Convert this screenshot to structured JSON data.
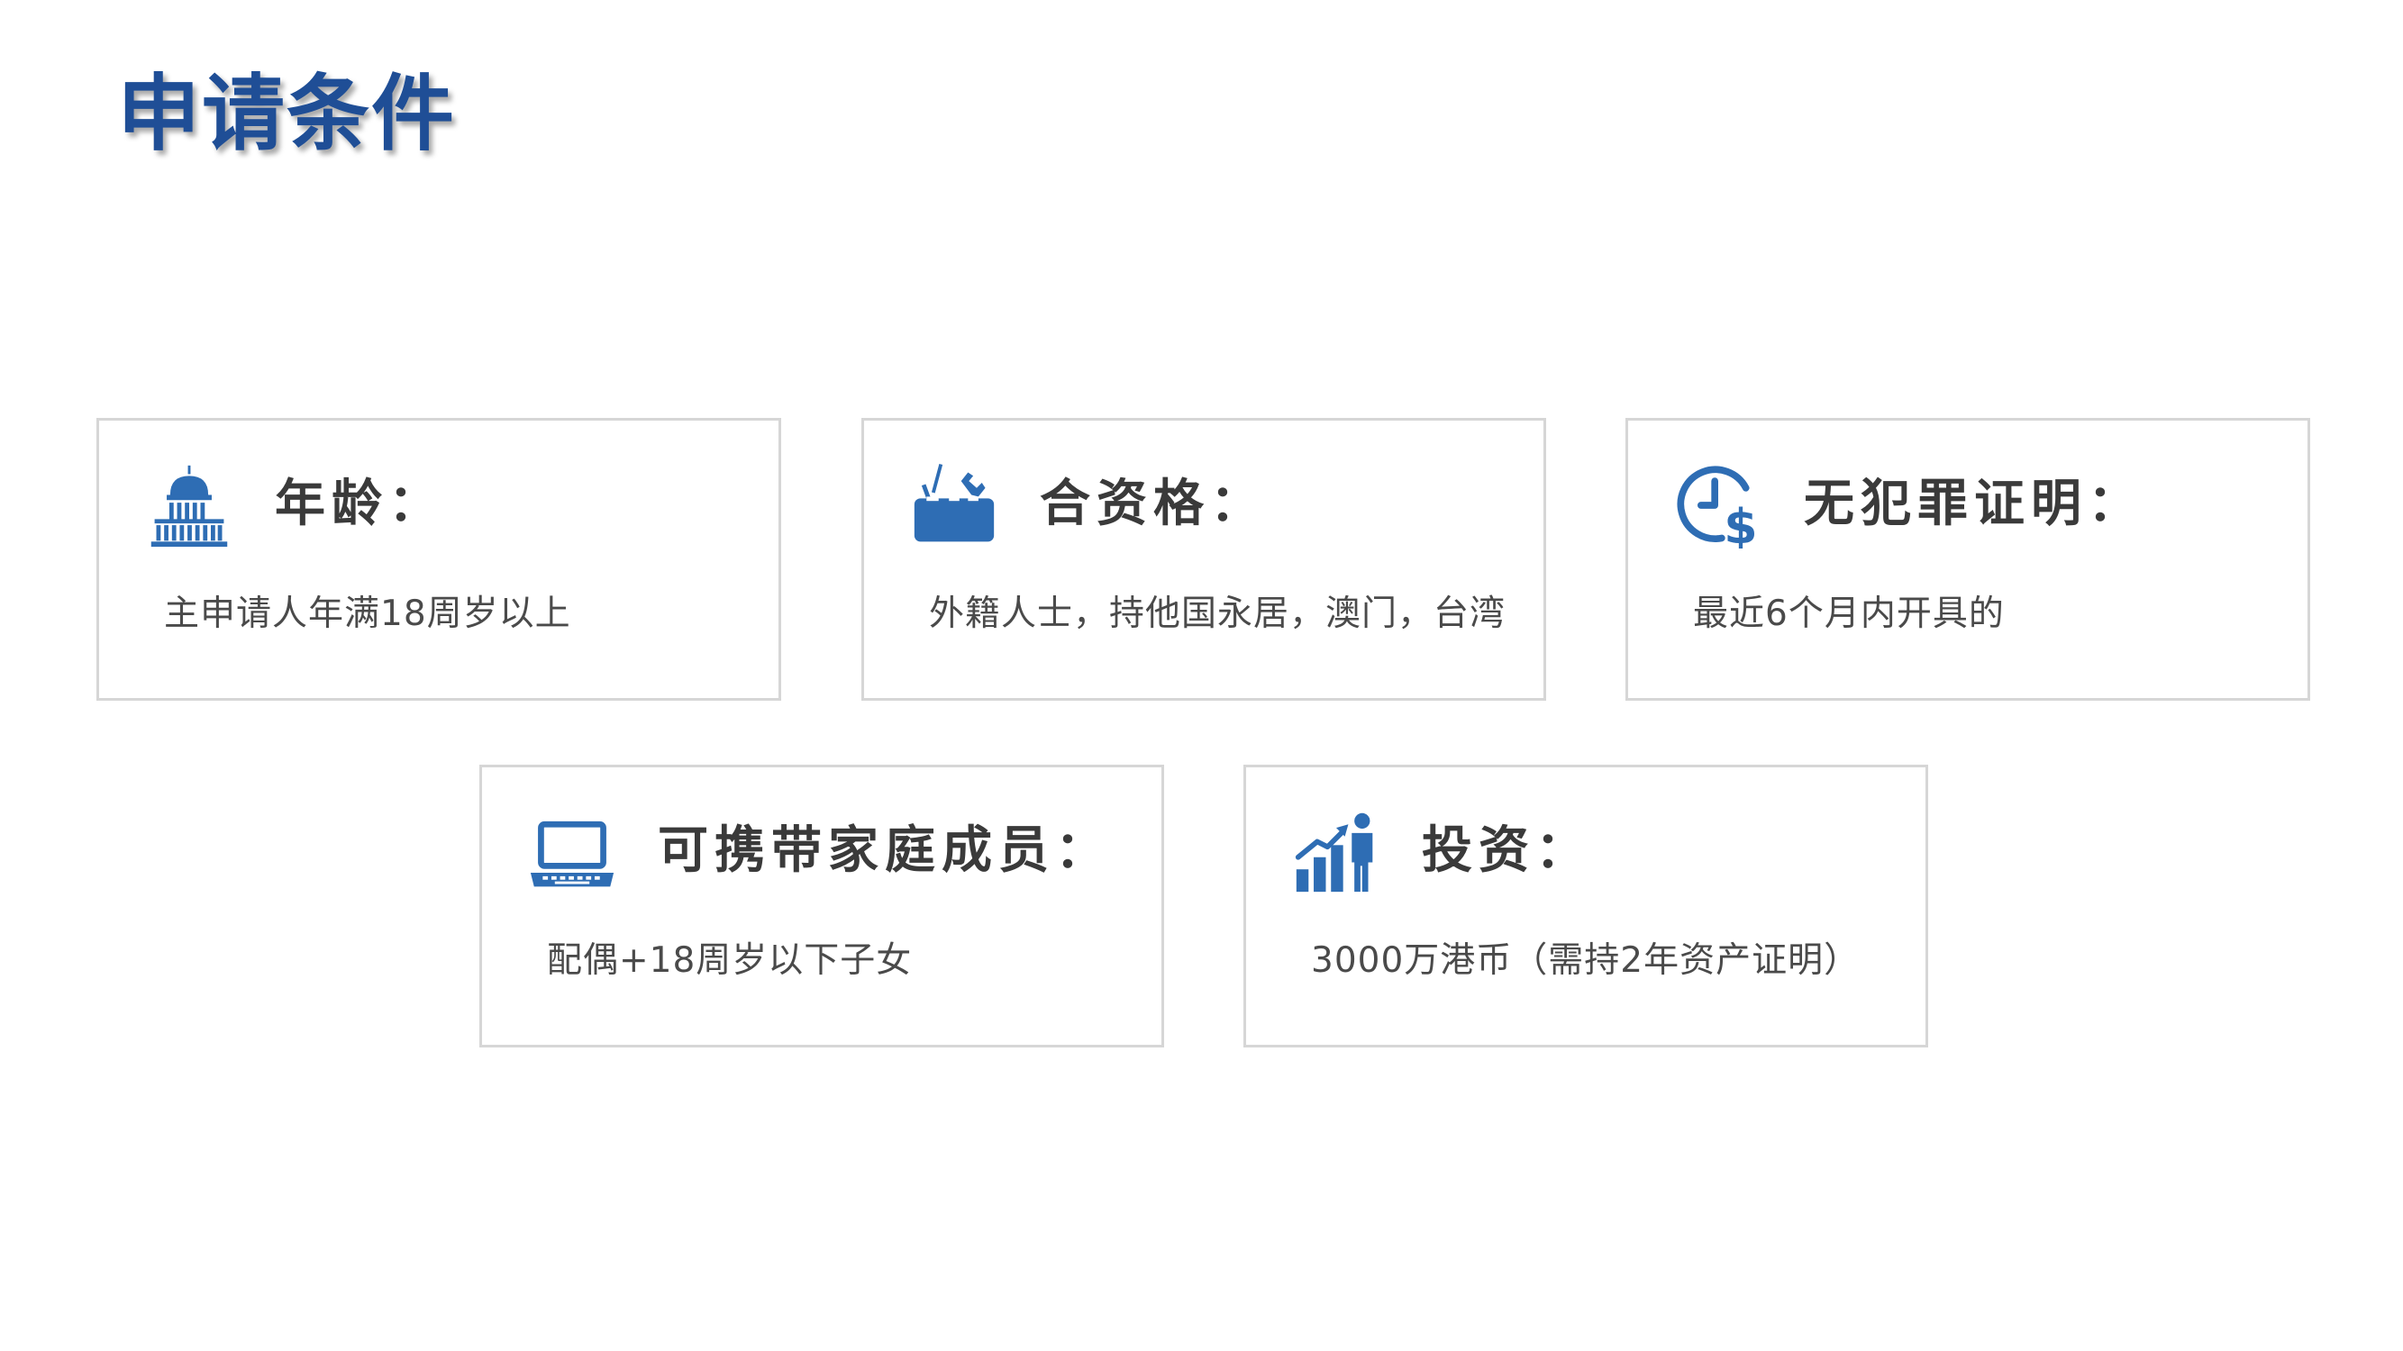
{
  "page": {
    "title": "申请条件"
  },
  "colors": {
    "title": "#1f4e96",
    "icon": "#2e6db4",
    "card_border": "#d6d6d6",
    "heading_text": "#3a3a3a",
    "body_text": "#4a4a4a"
  },
  "cards": {
    "age": {
      "icon": "capitol-building-icon",
      "title": "年龄：",
      "desc": "主申请人年满18周岁以上"
    },
    "qualification": {
      "icon": "toolbox-icon",
      "title": "合资格：",
      "desc": "外籍人士，持他国永居，澳门，台湾"
    },
    "criminal_record": {
      "icon": "clock-dollar-icon",
      "title": "无犯罪证明：",
      "desc": "最近6个月内开具的"
    },
    "family": {
      "icon": "laptop-icon",
      "title": "可携带家庭成员：",
      "desc": "配偶+18周岁以下子女"
    },
    "investment": {
      "icon": "growth-chart-person-icon",
      "title": "投资：",
      "desc": "3000万港币（需持2年资产证明）"
    }
  }
}
